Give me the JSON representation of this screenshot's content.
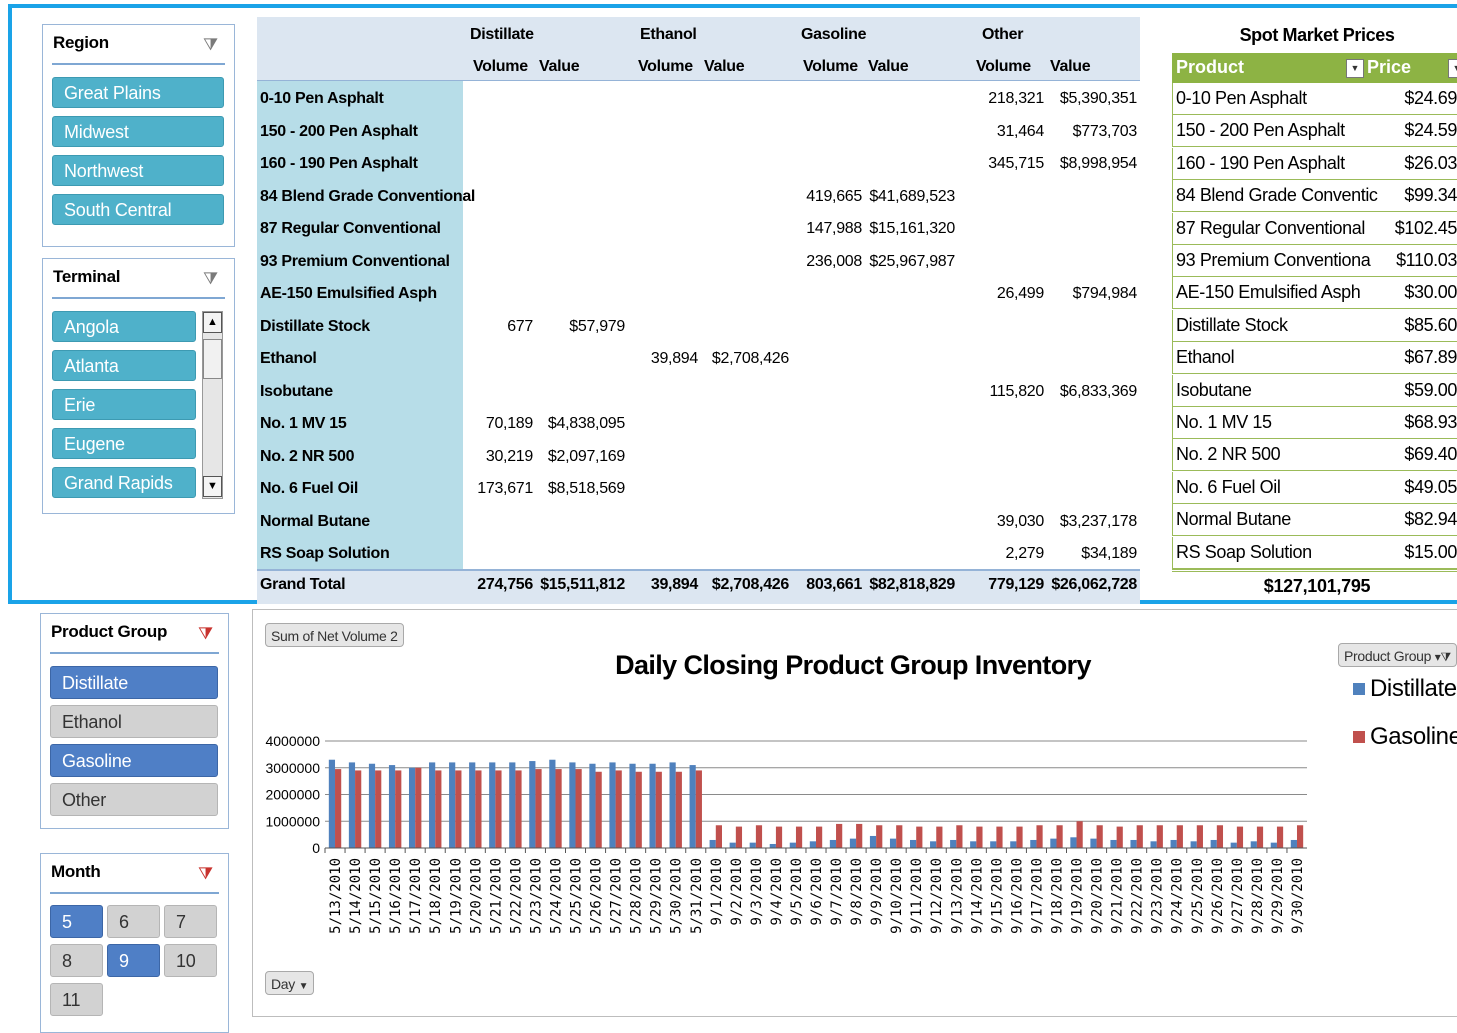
{
  "region_slicer": {
    "title": "Region",
    "items": [
      "Great Plains",
      "Midwest",
      "Northwest",
      "South Central"
    ]
  },
  "terminal_slicer": {
    "title": "Terminal",
    "items": [
      "Angola",
      "Atlanta",
      "Erie",
      "Eugene",
      "Grand Rapids"
    ]
  },
  "product_group_slicer": {
    "title": "Product Group",
    "items": [
      {
        "label": "Distillate",
        "selected": true
      },
      {
        "label": "Ethanol",
        "selected": false
      },
      {
        "label": "Gasoline",
        "selected": true
      },
      {
        "label": "Other",
        "selected": false
      }
    ]
  },
  "month_slicer": {
    "title": "Month",
    "items": [
      {
        "label": "5",
        "selected": true
      },
      {
        "label": "6",
        "selected": false
      },
      {
        "label": "7",
        "selected": false
      },
      {
        "label": "8",
        "selected": false
      },
      {
        "label": "9",
        "selected": true
      },
      {
        "label": "10",
        "selected": false
      },
      {
        "label": "11",
        "selected": false
      }
    ]
  },
  "pivot": {
    "groups": [
      "Distillate",
      "Ethanol",
      "Gasoline",
      "Other"
    ],
    "subheaders": [
      "Volume",
      "Value"
    ],
    "rows": [
      {
        "product": "0-10 Pen Asphalt",
        "cells": [
          "",
          "",
          "",
          "",
          "",
          "",
          "218,321",
          "$5,390,351"
        ]
      },
      {
        "product": "150 - 200 Pen Asphalt",
        "cells": [
          "",
          "",
          "",
          "",
          "",
          "",
          "31,464",
          "$773,703"
        ]
      },
      {
        "product": "160 - 190 Pen Asphalt",
        "cells": [
          "",
          "",
          "",
          "",
          "",
          "",
          "345,715",
          "$8,998,954"
        ]
      },
      {
        "product": "84 Blend Grade Conventional",
        "cells": [
          "",
          "",
          "",
          "",
          "419,665",
          "$41,689,523",
          "",
          ""
        ]
      },
      {
        "product": "87 Regular Conventional",
        "cells": [
          "",
          "",
          "",
          "",
          "147,988",
          "$15,161,320",
          "",
          ""
        ]
      },
      {
        "product": "93 Premium Conventional",
        "cells": [
          "",
          "",
          "",
          "",
          "236,008",
          "$25,967,987",
          "",
          ""
        ]
      },
      {
        "product": "AE-150 Emulsified Asph",
        "cells": [
          "",
          "",
          "",
          "",
          "",
          "",
          "26,499",
          "$794,984"
        ]
      },
      {
        "product": "Distillate Stock",
        "cells": [
          "677",
          "$57,979",
          "",
          "",
          "",
          "",
          "",
          ""
        ]
      },
      {
        "product": "Ethanol",
        "cells": [
          "",
          "",
          "39,894",
          "$2,708,426",
          "",
          "",
          "",
          ""
        ]
      },
      {
        "product": "Isobutane",
        "cells": [
          "",
          "",
          "",
          "",
          "",
          "",
          "115,820",
          "$6,833,369"
        ]
      },
      {
        "product": "No. 1 MV 15",
        "cells": [
          "70,189",
          "$4,838,095",
          "",
          "",
          "",
          "",
          "",
          ""
        ]
      },
      {
        "product": "No. 2 NR 500",
        "cells": [
          "30,219",
          "$2,097,169",
          "",
          "",
          "",
          "",
          "",
          ""
        ]
      },
      {
        "product": "No. 6 Fuel Oil",
        "cells": [
          "173,671",
          "$8,518,569",
          "",
          "",
          "",
          "",
          "",
          ""
        ]
      },
      {
        "product": "Normal Butane",
        "cells": [
          "",
          "",
          "",
          "",
          "",
          "",
          "39,030",
          "$3,237,178"
        ]
      },
      {
        "product": "RS Soap Solution",
        "cells": [
          "",
          "",
          "",
          "",
          "",
          "",
          "2,279",
          "$34,189"
        ]
      }
    ],
    "total": {
      "label": "Grand Total",
      "cells": [
        "274,756",
        "$15,511,812",
        "39,894",
        "$2,708,426",
        "803,661",
        "$82,818,829",
        "779,129",
        "$26,062,728"
      ]
    }
  },
  "spot": {
    "title": "Spot Market Prices",
    "col_product": "Product",
    "col_price": "Price",
    "rows": [
      {
        "product": "0-10 Pen Asphalt",
        "price": "$24.69"
      },
      {
        "product": "150 - 200 Pen Asphalt",
        "price": "$24.59"
      },
      {
        "product": "160 - 190 Pen Asphalt",
        "price": "$26.03"
      },
      {
        "product": "84 Blend Grade Conventic",
        "price": "$99.34"
      },
      {
        "product": "87 Regular Conventional",
        "price": "$102.45"
      },
      {
        "product": "93 Premium Conventiona",
        "price": "$110.03"
      },
      {
        "product": "AE-150 Emulsified Asph",
        "price": "$30.00"
      },
      {
        "product": "Distillate Stock",
        "price": "$85.60"
      },
      {
        "product": "Ethanol",
        "price": "$67.89"
      },
      {
        "product": "Isobutane",
        "price": "$59.00"
      },
      {
        "product": "No. 1 MV 15",
        "price": "$68.93"
      },
      {
        "product": "No. 2 NR 500",
        "price": "$69.40"
      },
      {
        "product": "No. 6 Fuel Oil",
        "price": "$49.05"
      },
      {
        "product": "Normal Butane",
        "price": "$82.94"
      },
      {
        "product": "RS Soap Solution",
        "price": "$15.00"
      }
    ],
    "total": "$127,101,795"
  },
  "chart_buttons": {
    "field": "Sum of Net Volume 2",
    "legend_filter": "Product Group",
    "axis_field": "Day"
  },
  "colors": {
    "distillate": "#4f81bd",
    "gasoline": "#c0504d"
  },
  "chart_data": {
    "type": "bar",
    "title": "Daily Closing Product Group Inventory",
    "legend_position": "right",
    "ylim": [
      0,
      4000000
    ],
    "yticks": [
      "4000000",
      "3000000",
      "2000000",
      "1000000",
      "0"
    ],
    "grid": true,
    "categories": [
      "5/13/2010",
      "5/14/2010",
      "5/15/2010",
      "5/16/2010",
      "5/17/2010",
      "5/18/2010",
      "5/19/2010",
      "5/20/2010",
      "5/21/2010",
      "5/22/2010",
      "5/23/2010",
      "5/24/2010",
      "5/25/2010",
      "5/26/2010",
      "5/27/2010",
      "5/28/2010",
      "5/29/2010",
      "5/30/2010",
      "5/31/2010",
      "9/1/2010",
      "9/2/2010",
      "9/3/2010",
      "9/4/2010",
      "9/5/2010",
      "9/6/2010",
      "9/7/2010",
      "9/8/2010",
      "9/9/2010",
      "9/10/2010",
      "9/11/2010",
      "9/12/2010",
      "9/13/2010",
      "9/14/2010",
      "9/15/2010",
      "9/16/2010",
      "9/17/2010",
      "9/18/2010",
      "9/19/2010",
      "9/20/2010",
      "9/21/2010",
      "9/22/2010",
      "9/23/2010",
      "9/24/2010",
      "9/25/2010",
      "9/26/2010",
      "9/27/2010",
      "9/28/2010",
      "9/29/2010",
      "9/30/2010"
    ],
    "series": [
      {
        "name": "Distillate",
        "values": [
          3300000,
          3200000,
          3150000,
          3100000,
          3000000,
          3200000,
          3200000,
          3200000,
          3200000,
          3200000,
          3250000,
          3300000,
          3200000,
          3150000,
          3200000,
          3150000,
          3150000,
          3200000,
          3100000,
          300000,
          200000,
          200000,
          150000,
          200000,
          250000,
          300000,
          350000,
          450000,
          350000,
          300000,
          250000,
          300000,
          250000,
          250000,
          250000,
          300000,
          350000,
          400000,
          350000,
          300000,
          300000,
          250000,
          300000,
          250000,
          300000,
          200000,
          250000,
          200000,
          300000
        ]
      },
      {
        "name": "Gasoline",
        "values": [
          2950000,
          2900000,
          2900000,
          2900000,
          3000000,
          2900000,
          2900000,
          2900000,
          2900000,
          2900000,
          2950000,
          2950000,
          2950000,
          2850000,
          2900000,
          2850000,
          2850000,
          2850000,
          2900000,
          850000,
          800000,
          850000,
          800000,
          800000,
          800000,
          900000,
          900000,
          850000,
          850000,
          800000,
          800000,
          850000,
          800000,
          800000,
          800000,
          850000,
          850000,
          1000000,
          850000,
          800000,
          850000,
          850000,
          850000,
          850000,
          850000,
          800000,
          800000,
          800000,
          850000
        ]
      }
    ]
  }
}
